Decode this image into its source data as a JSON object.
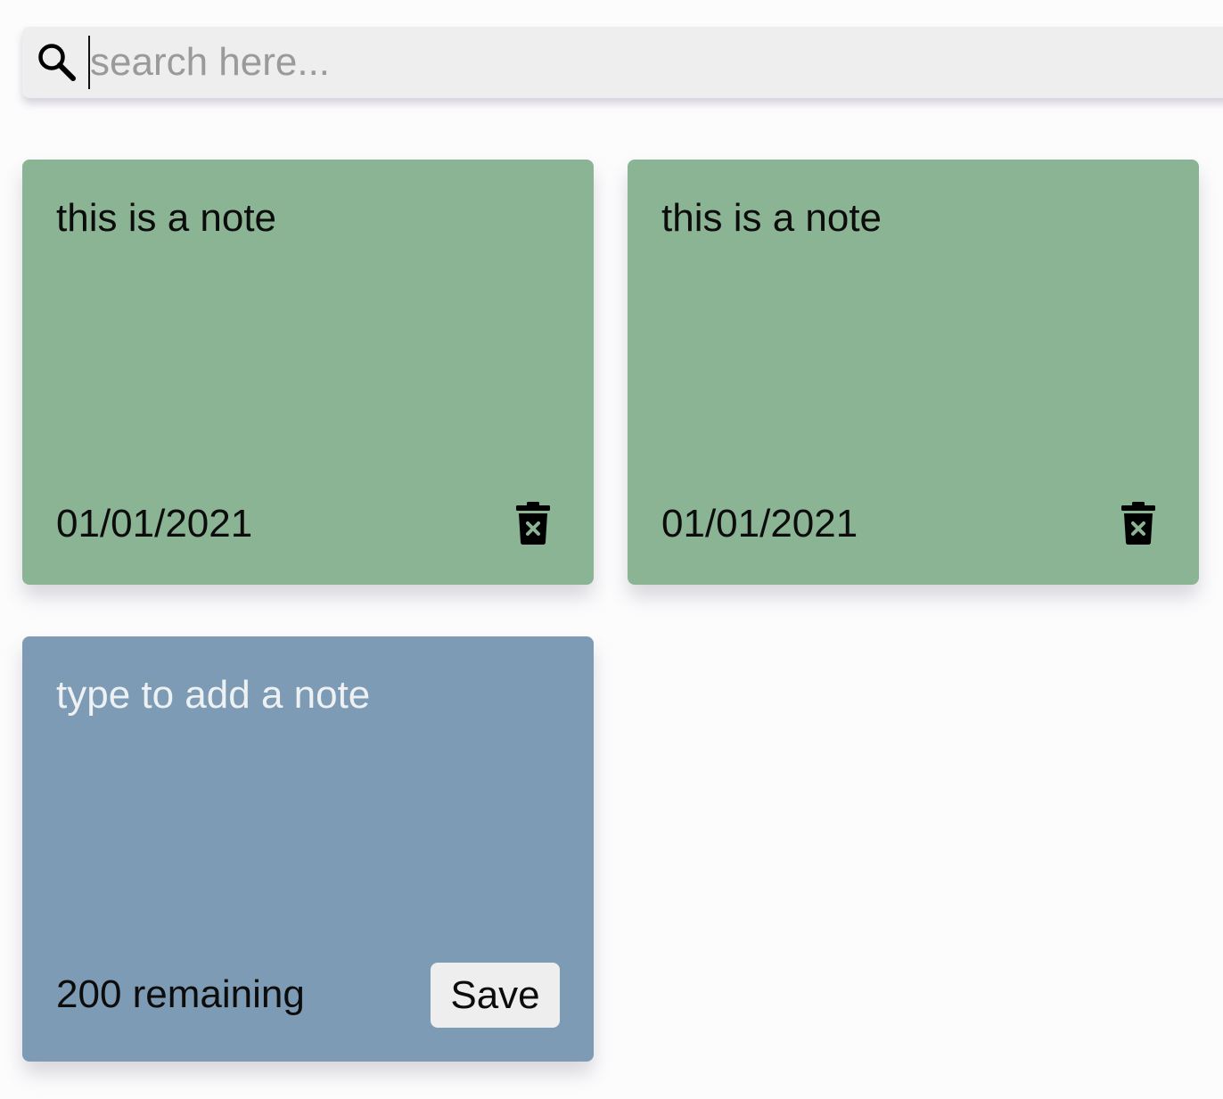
{
  "search": {
    "placeholder": "search here...",
    "value": ""
  },
  "notes": [
    {
      "text": "this is a note",
      "date": "01/01/2021",
      "icon": "trash-icon"
    },
    {
      "text": "this is a note",
      "date": "01/01/2021",
      "icon": "trash-icon"
    }
  ],
  "new_note": {
    "placeholder": "type to add a note",
    "remaining_text": "200 remaining",
    "save_label": "Save"
  },
  "colors": {
    "note_saved": "#8bb494",
    "note_new": "#7d9bb4",
    "search_bg": "#eeeeee",
    "page_bg": "#fdfcfd"
  }
}
